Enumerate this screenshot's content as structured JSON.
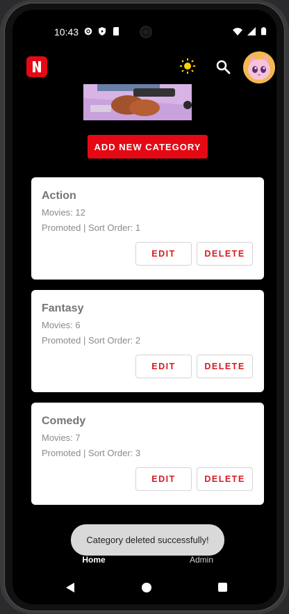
{
  "status_bar": {
    "time": "10:43"
  },
  "header": {
    "logo_letter": "N",
    "icons": [
      "theme-sun-icon",
      "search-icon",
      "avatar"
    ]
  },
  "add_category_label": "ADD NEW CATEGORY",
  "categories": [
    {
      "name": "Action",
      "movies": "Movies: 12",
      "meta": "Promoted | Sort Order: 1",
      "edit_label": "EDIT",
      "delete_label": "DELETE"
    },
    {
      "name": "Fantasy",
      "movies": "Movies: 6",
      "meta": "Promoted | Sort Order: 2",
      "edit_label": "EDIT",
      "delete_label": "DELETE"
    },
    {
      "name": "Comedy",
      "movies": "Movies: 7",
      "meta": "Promoted | Sort Order: 3",
      "edit_label": "EDIT",
      "delete_label": "DELETE"
    }
  ],
  "toast": "Category deleted successfully!",
  "bottom_nav": [
    {
      "label": "Home",
      "icon": "home-icon"
    },
    {
      "label": "Admin",
      "icon": "person-icon"
    }
  ],
  "colors": {
    "accent": "#e50914",
    "background": "#000000",
    "card": "#ffffff"
  }
}
